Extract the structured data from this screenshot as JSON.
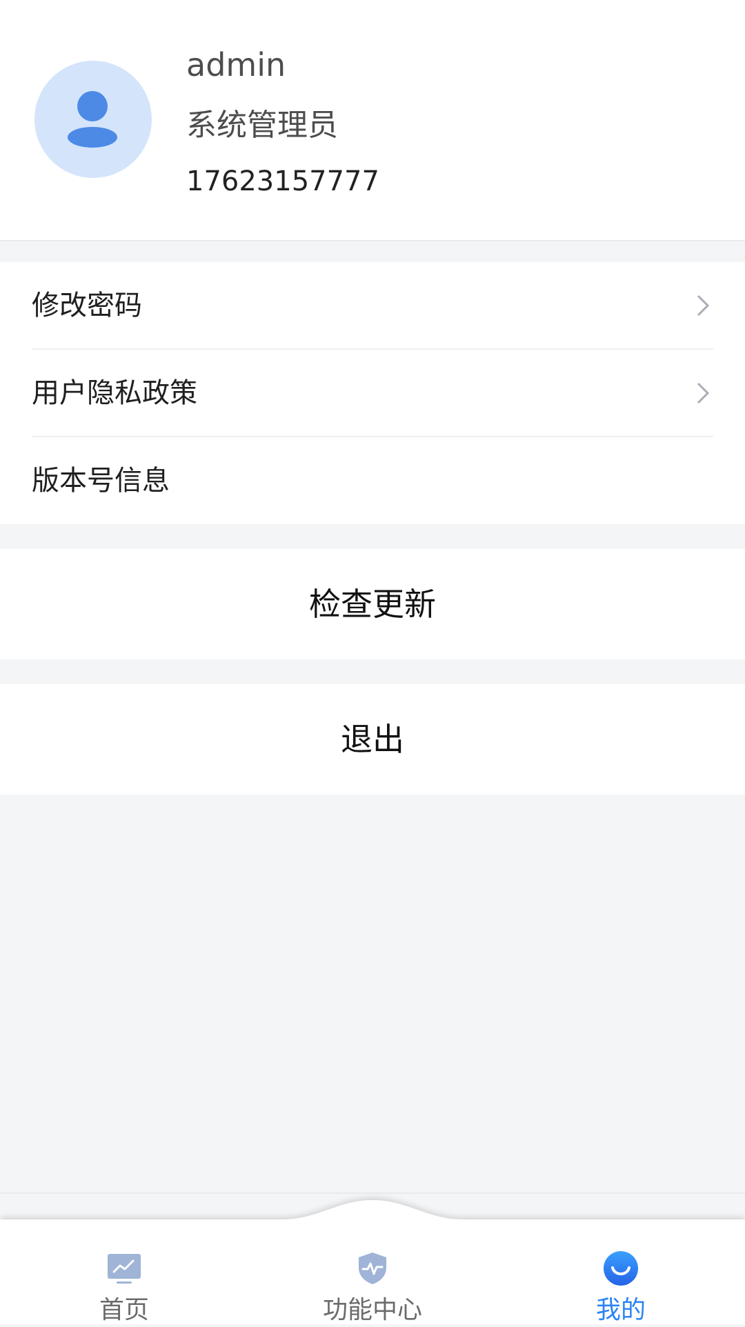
{
  "profile": {
    "username": "admin",
    "role": "系统管理员",
    "phone": "17623157777",
    "avatar_icon": "user-icon"
  },
  "menu": {
    "items": [
      {
        "label": "修改密码",
        "has_arrow": true
      },
      {
        "label": "用户隐私政策",
        "has_arrow": true
      },
      {
        "label": "版本号信息",
        "has_arrow": false
      }
    ]
  },
  "actions": {
    "check_update": "检查更新",
    "logout": "退出"
  },
  "tabbar": {
    "tabs": [
      {
        "label": "首页",
        "icon": "monitor-chart-icon",
        "active": false
      },
      {
        "label": "功能中心",
        "icon": "shield-pulse-icon",
        "active": false
      },
      {
        "label": "我的",
        "icon": "smile-icon",
        "active": true
      }
    ]
  },
  "colors": {
    "accent": "#2c84f4",
    "background": "#f4f5f7",
    "avatar_bg": "#d4e4fb",
    "icon_inactive": "#9fb4d6"
  }
}
